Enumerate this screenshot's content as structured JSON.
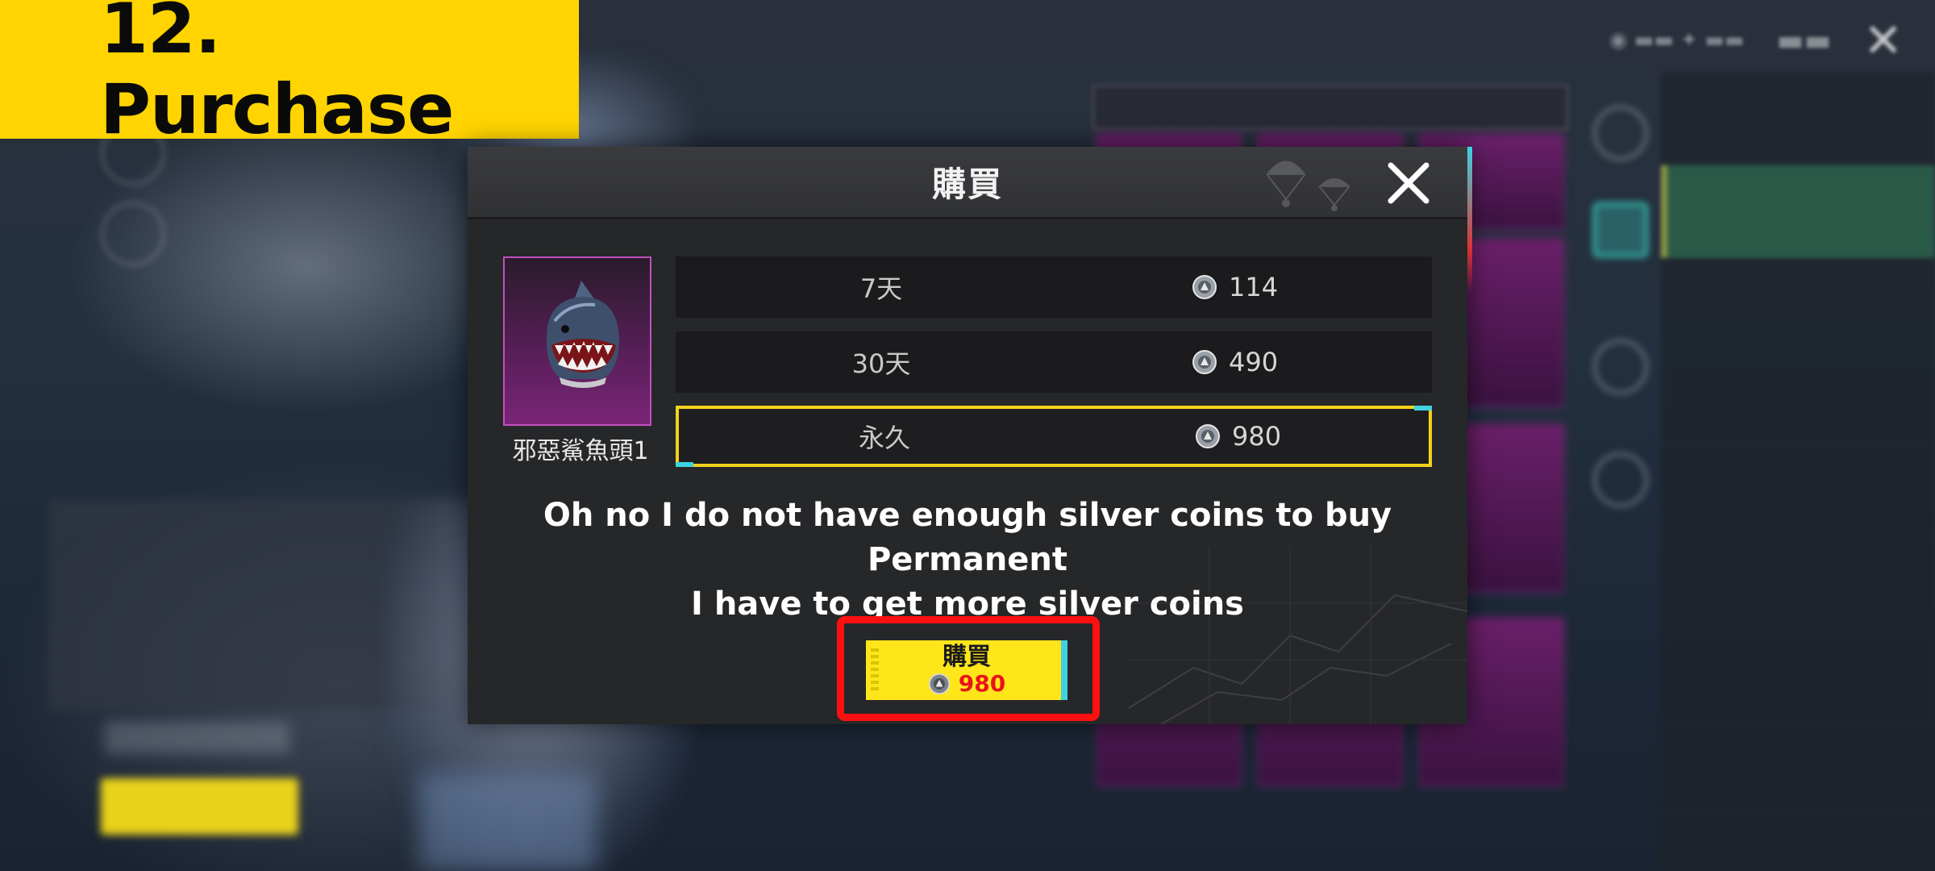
{
  "tutorial": {
    "step_title": "12. Purchase",
    "message_line1": "Oh no I do not have enough silver coins to buy Permanent",
    "message_line2": "I have to get more silver coins"
  },
  "dialog": {
    "title": "購買",
    "item_name": "邪惡鯊魚頭1",
    "options": [
      {
        "duration": "7天",
        "price": "114",
        "selected": false
      },
      {
        "duration": "30天",
        "price": "490",
        "selected": false
      },
      {
        "duration": "永久",
        "price": "980",
        "selected": true
      }
    ],
    "buy_button": {
      "label": "購買",
      "price": "980"
    }
  },
  "colors": {
    "tag_yellow": "#ffd400",
    "selected_border": "#f4d11c",
    "buy_button": "#ffe61a",
    "buy_price": "#e8141a",
    "highlight_red": "#ff1010",
    "item_frame": "#c24fbd"
  },
  "icons": {
    "currency": "silver-coin-icon",
    "close": "close-icon",
    "item": "shark-helmet-icon"
  }
}
